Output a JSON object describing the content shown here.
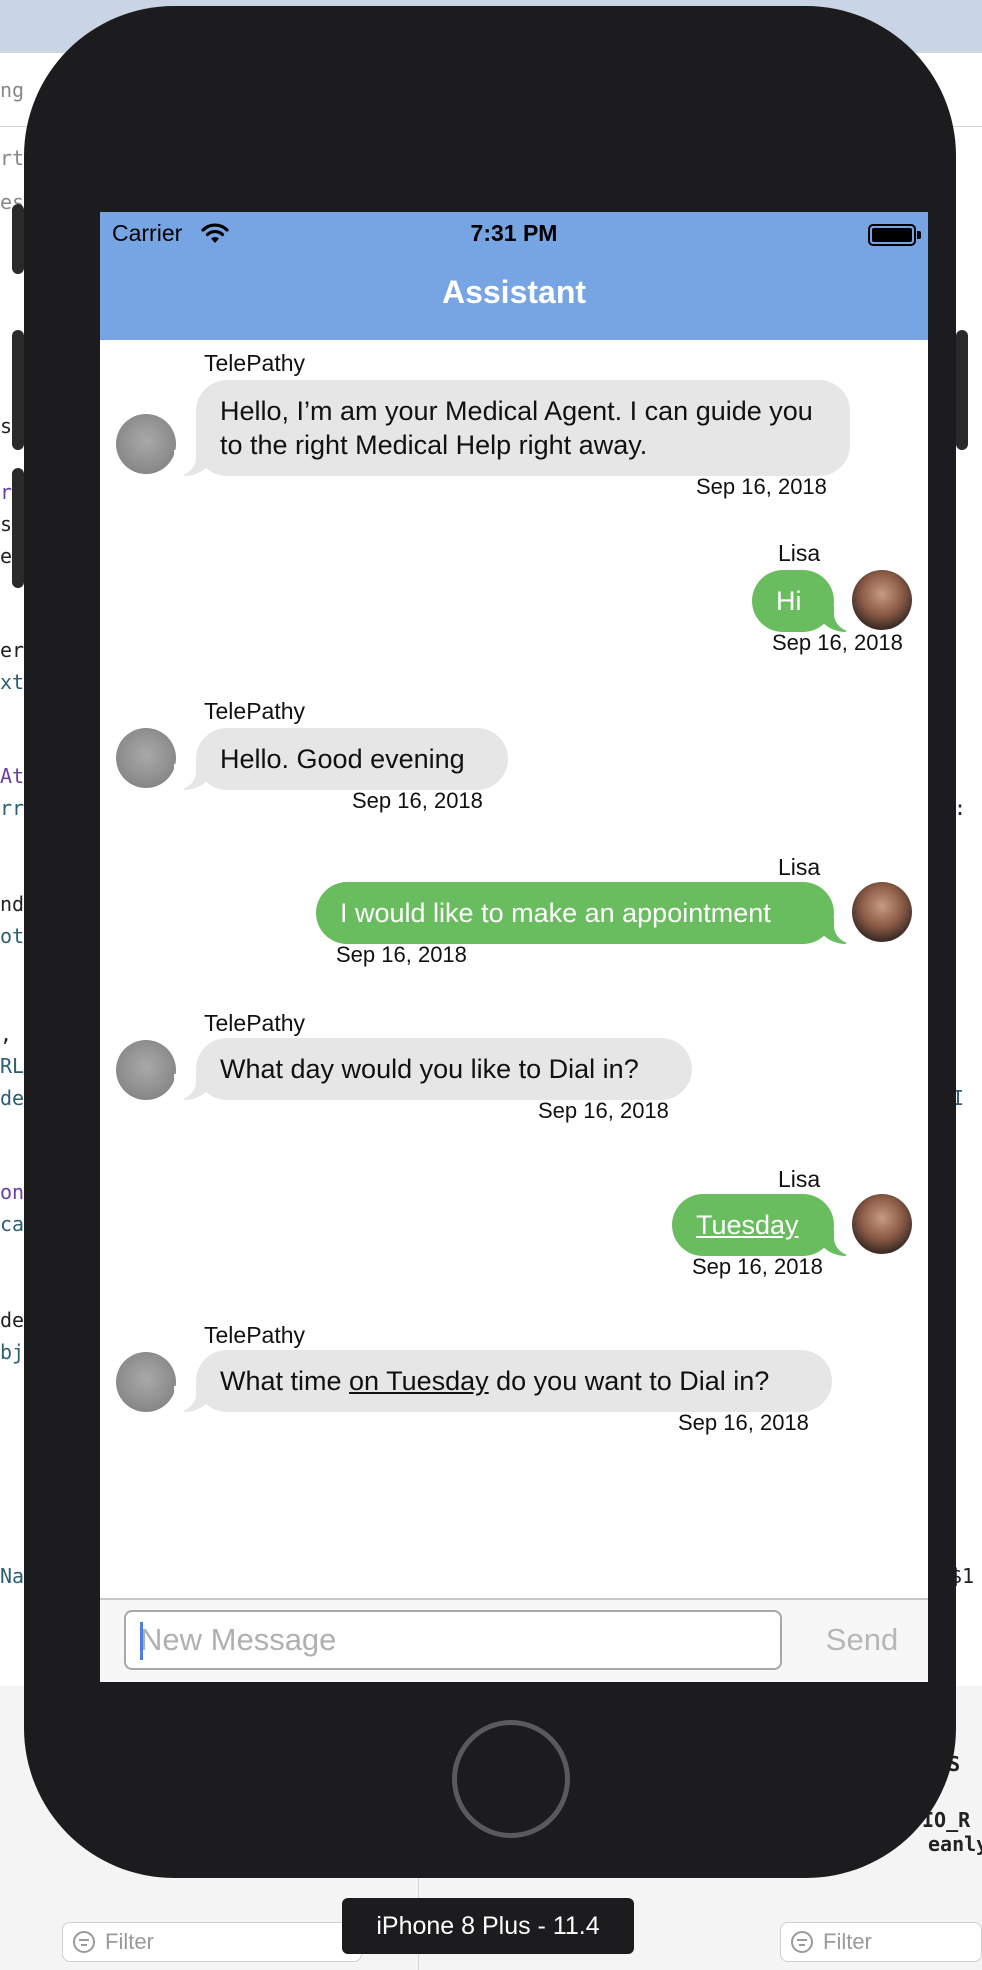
{
  "background": {
    "code_fragments": [
      "ng",
      "rtu",
      "es",
      "s",
      "r",
      "ss",
      "e",
      "er",
      "xt",
      "At",
      "rr",
      "nde",
      "ote",
      ", S",
      "RLW",
      "dec",
      "on",
      "cat",
      "der",
      "bj",
      "Nar",
      "e:",
      "eI",
      "$1",
      "ASS",
      "IO_R",
      "eanly"
    ],
    "filter_left": "Filter",
    "filter_right": "Filter"
  },
  "device": {
    "label": "iPhone 8 Plus - 11.4"
  },
  "status_bar": {
    "carrier": "Carrier",
    "time": "7:31 PM"
  },
  "nav": {
    "title": "Assistant"
  },
  "messages": [
    {
      "sender": "TelePathy",
      "text": "Hello, I’m am your Medical Agent. I can guide you to the right Medical Help right away.",
      "date": "Sep 16, 2018"
    },
    {
      "sender": "Lisa",
      "text": "Hi",
      "date": "Sep 16, 2018"
    },
    {
      "sender": "TelePathy",
      "text": "Hello. Good evening",
      "date": "Sep 16, 2018"
    },
    {
      "sender": "Lisa",
      "text": "I would like to make an appointment",
      "date": "Sep 16, 2018"
    },
    {
      "sender": "TelePathy",
      "text": "What day would you like to Dial in?",
      "date": "Sep 16, 2018"
    },
    {
      "sender": "Lisa",
      "text": "Tuesday",
      "date": "Sep 16, 2018"
    },
    {
      "sender": "TelePathy",
      "text_before": "What time ",
      "text_link": "on Tuesday",
      "text_after": " do you want to Dial in?",
      "date": "Sep 16, 2018"
    }
  ],
  "input": {
    "placeholder": "New Message",
    "send_label": "Send"
  },
  "colors": {
    "nav_bar": "#77a4e2",
    "outgoing_bubble": "#6abd5f",
    "incoming_bubble": "#e6e6e6"
  }
}
